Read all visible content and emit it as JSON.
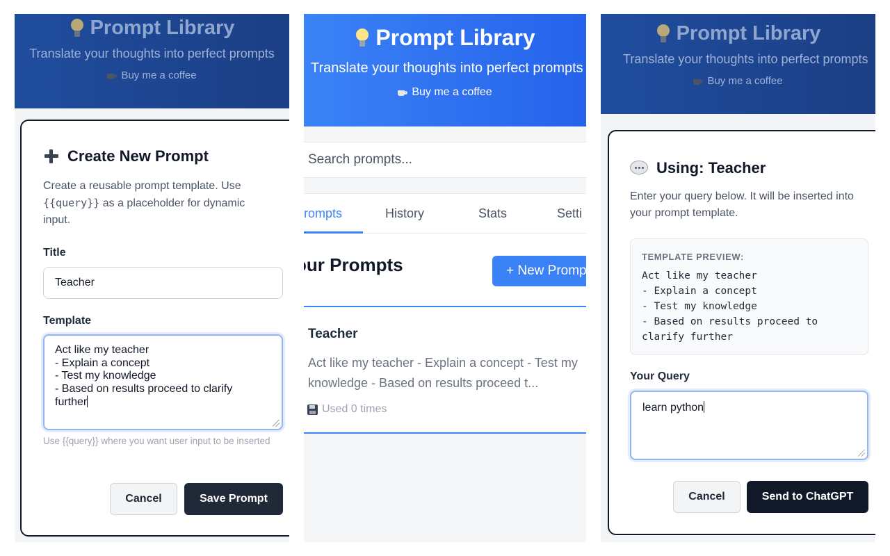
{
  "app": {
    "title": "Prompt Library",
    "subtitle": "Translate your thoughts into perfect prompts",
    "coffee_label": "Buy me a coffee"
  },
  "create_modal": {
    "title": "Create New Prompt",
    "desc_before": "Create a reusable prompt template. Use ",
    "desc_code": "{{query}}",
    "desc_after": " as a placeholder for dynamic input.",
    "title_label": "Title",
    "title_value": "Teacher",
    "template_label": "Template",
    "template_lines": [
      "Act like my teacher",
      "- Explain a concept",
      "- Test my knowledge",
      "- Based on results proceed to clarify",
      "further"
    ],
    "hint": "Use {{query}} where you want user input to be inserted",
    "cancel_label": "Cancel",
    "save_label": "Save Prompt"
  },
  "main": {
    "search_placeholder": "Search prompts...",
    "tabs": [
      {
        "label": "Prompts",
        "shown": "rompts"
      },
      {
        "label": "History"
      },
      {
        "label": "Stats"
      },
      {
        "label": "Settings",
        "shown": "Setti"
      }
    ],
    "section_title": "Your Prompts",
    "section_title_shown": "our Prompts",
    "new_button_shown": "+ New Promp",
    "card": {
      "title": "Teacher",
      "preview": "Act like my teacher - Explain a concept - Test my knowledge - Based on results proceed t...",
      "usage": "Used 0 times"
    }
  },
  "use_modal": {
    "title": "Using: Teacher",
    "desc": "Enter your query below. It will be inserted into your prompt template.",
    "preview_label": "TEMPLATE PREVIEW:",
    "preview_text": "Act like my teacher\n- Explain a concept\n- Test my knowledge\n- Based on results proceed to\nclarify further",
    "query_label": "Your Query",
    "query_value": "learn python",
    "cancel_label": "Cancel",
    "send_label": "Send to ChatGPT"
  },
  "colors": {
    "accent": "#3b82f6",
    "dark_button": "#1f2937"
  }
}
